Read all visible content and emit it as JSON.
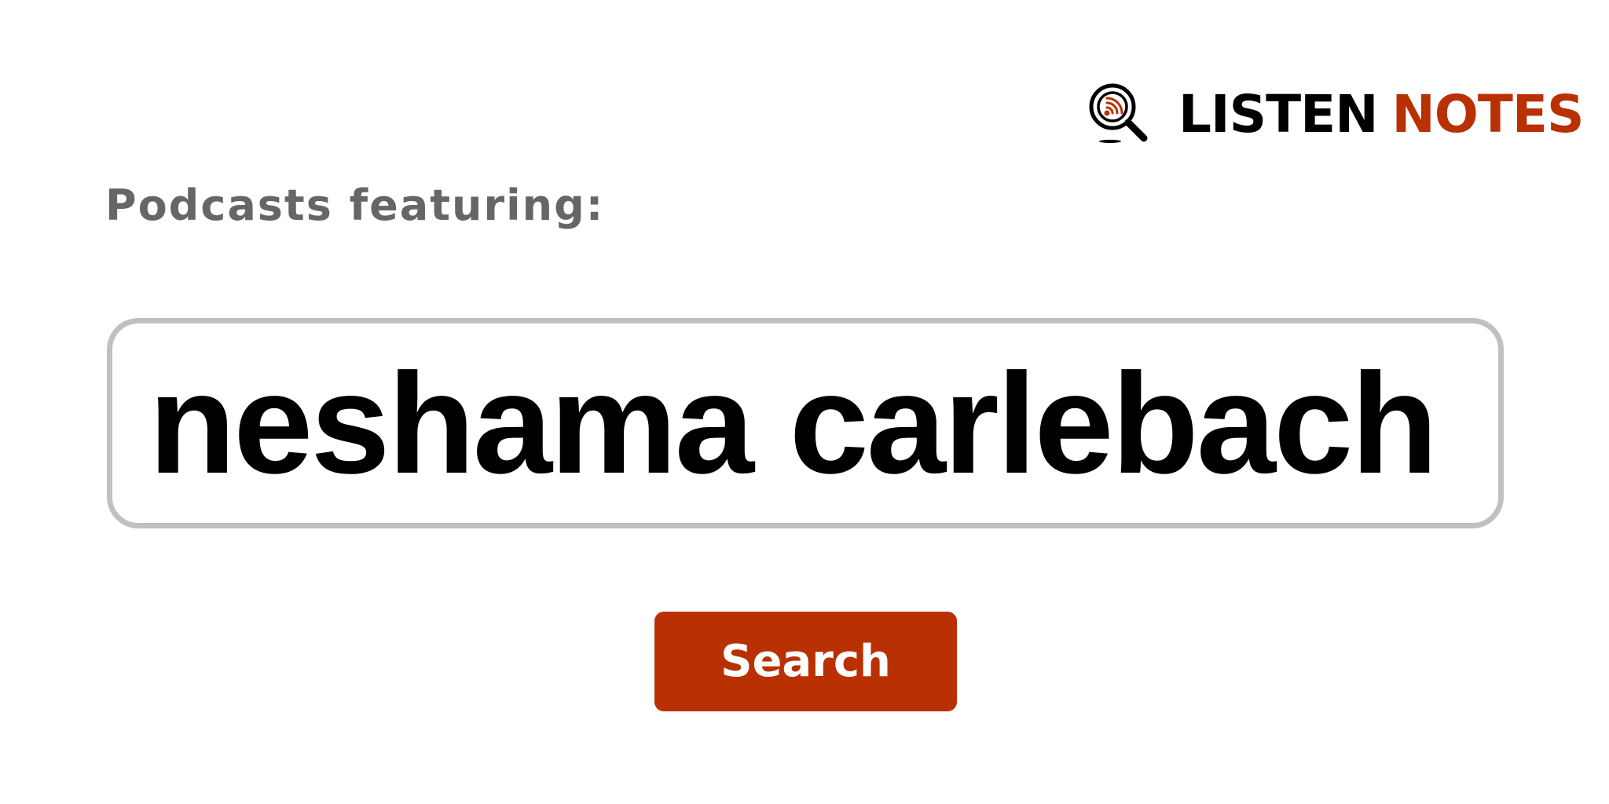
{
  "brand": {
    "icon": "magnifier-podcast-icon",
    "word_1": "LISTEN",
    "word_2": "NOTES",
    "accent_color": "#b93003"
  },
  "prompt": {
    "label": "Podcasts featuring:"
  },
  "search": {
    "value": "neshama carlebach",
    "button_label": "Search"
  }
}
